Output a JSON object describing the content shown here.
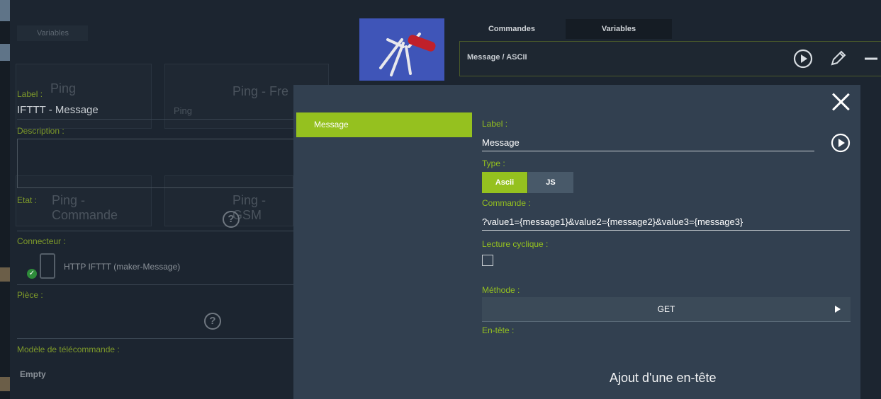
{
  "background": {
    "tab_button": "Variables",
    "left_panel": {
      "label_caption": "Label :",
      "label_value": "IFTTT - Message",
      "description_caption": "Description :",
      "etat_caption": "Etat :",
      "connecteur_caption": "Connecteur :",
      "connecteur_value": "HTTP IFTTT (maker-Message)",
      "piece_caption": "Pièce :",
      "modele_caption": "Modèle de télécommande :",
      "modele_value": "Empty"
    },
    "cards": {
      "ping_left": "Ping",
      "ping_right": "Ping - Fre",
      "ping_sub": "Ping",
      "ping_commande": "Ping - Commande",
      "ping_gsm": "Ping - GSM"
    }
  },
  "header": {
    "tabs": [
      {
        "label": "Commandes",
        "active": false
      },
      {
        "label": "Variables",
        "active": true
      }
    ],
    "command_title": "Message  /  ASCII",
    "icons": [
      "play-icon",
      "pencil-icon",
      "minus-icon"
    ]
  },
  "modal": {
    "sidebar": [
      {
        "label": "Message",
        "active": true
      }
    ],
    "label_caption": "Label :",
    "label_value": "Message",
    "type_caption": "Type :",
    "type_options": [
      {
        "label": "Ascii",
        "selected": true
      },
      {
        "label": "JS",
        "selected": false
      }
    ],
    "commande_caption": "Commande :",
    "commande_value": "?value1={message1}&value2={message2}&value3={message3}",
    "cyclic_caption": "Lecture cyclique :",
    "cyclic_checked": false,
    "methode_caption": "Méthode :",
    "methode_value": "GET",
    "entete_caption": "En-tête :",
    "add_header_label": "Ajout d'une en-tête"
  },
  "colors": {
    "accent": "#95c11f",
    "modal_bg": "#324050",
    "page_bg": "#1c2530"
  }
}
